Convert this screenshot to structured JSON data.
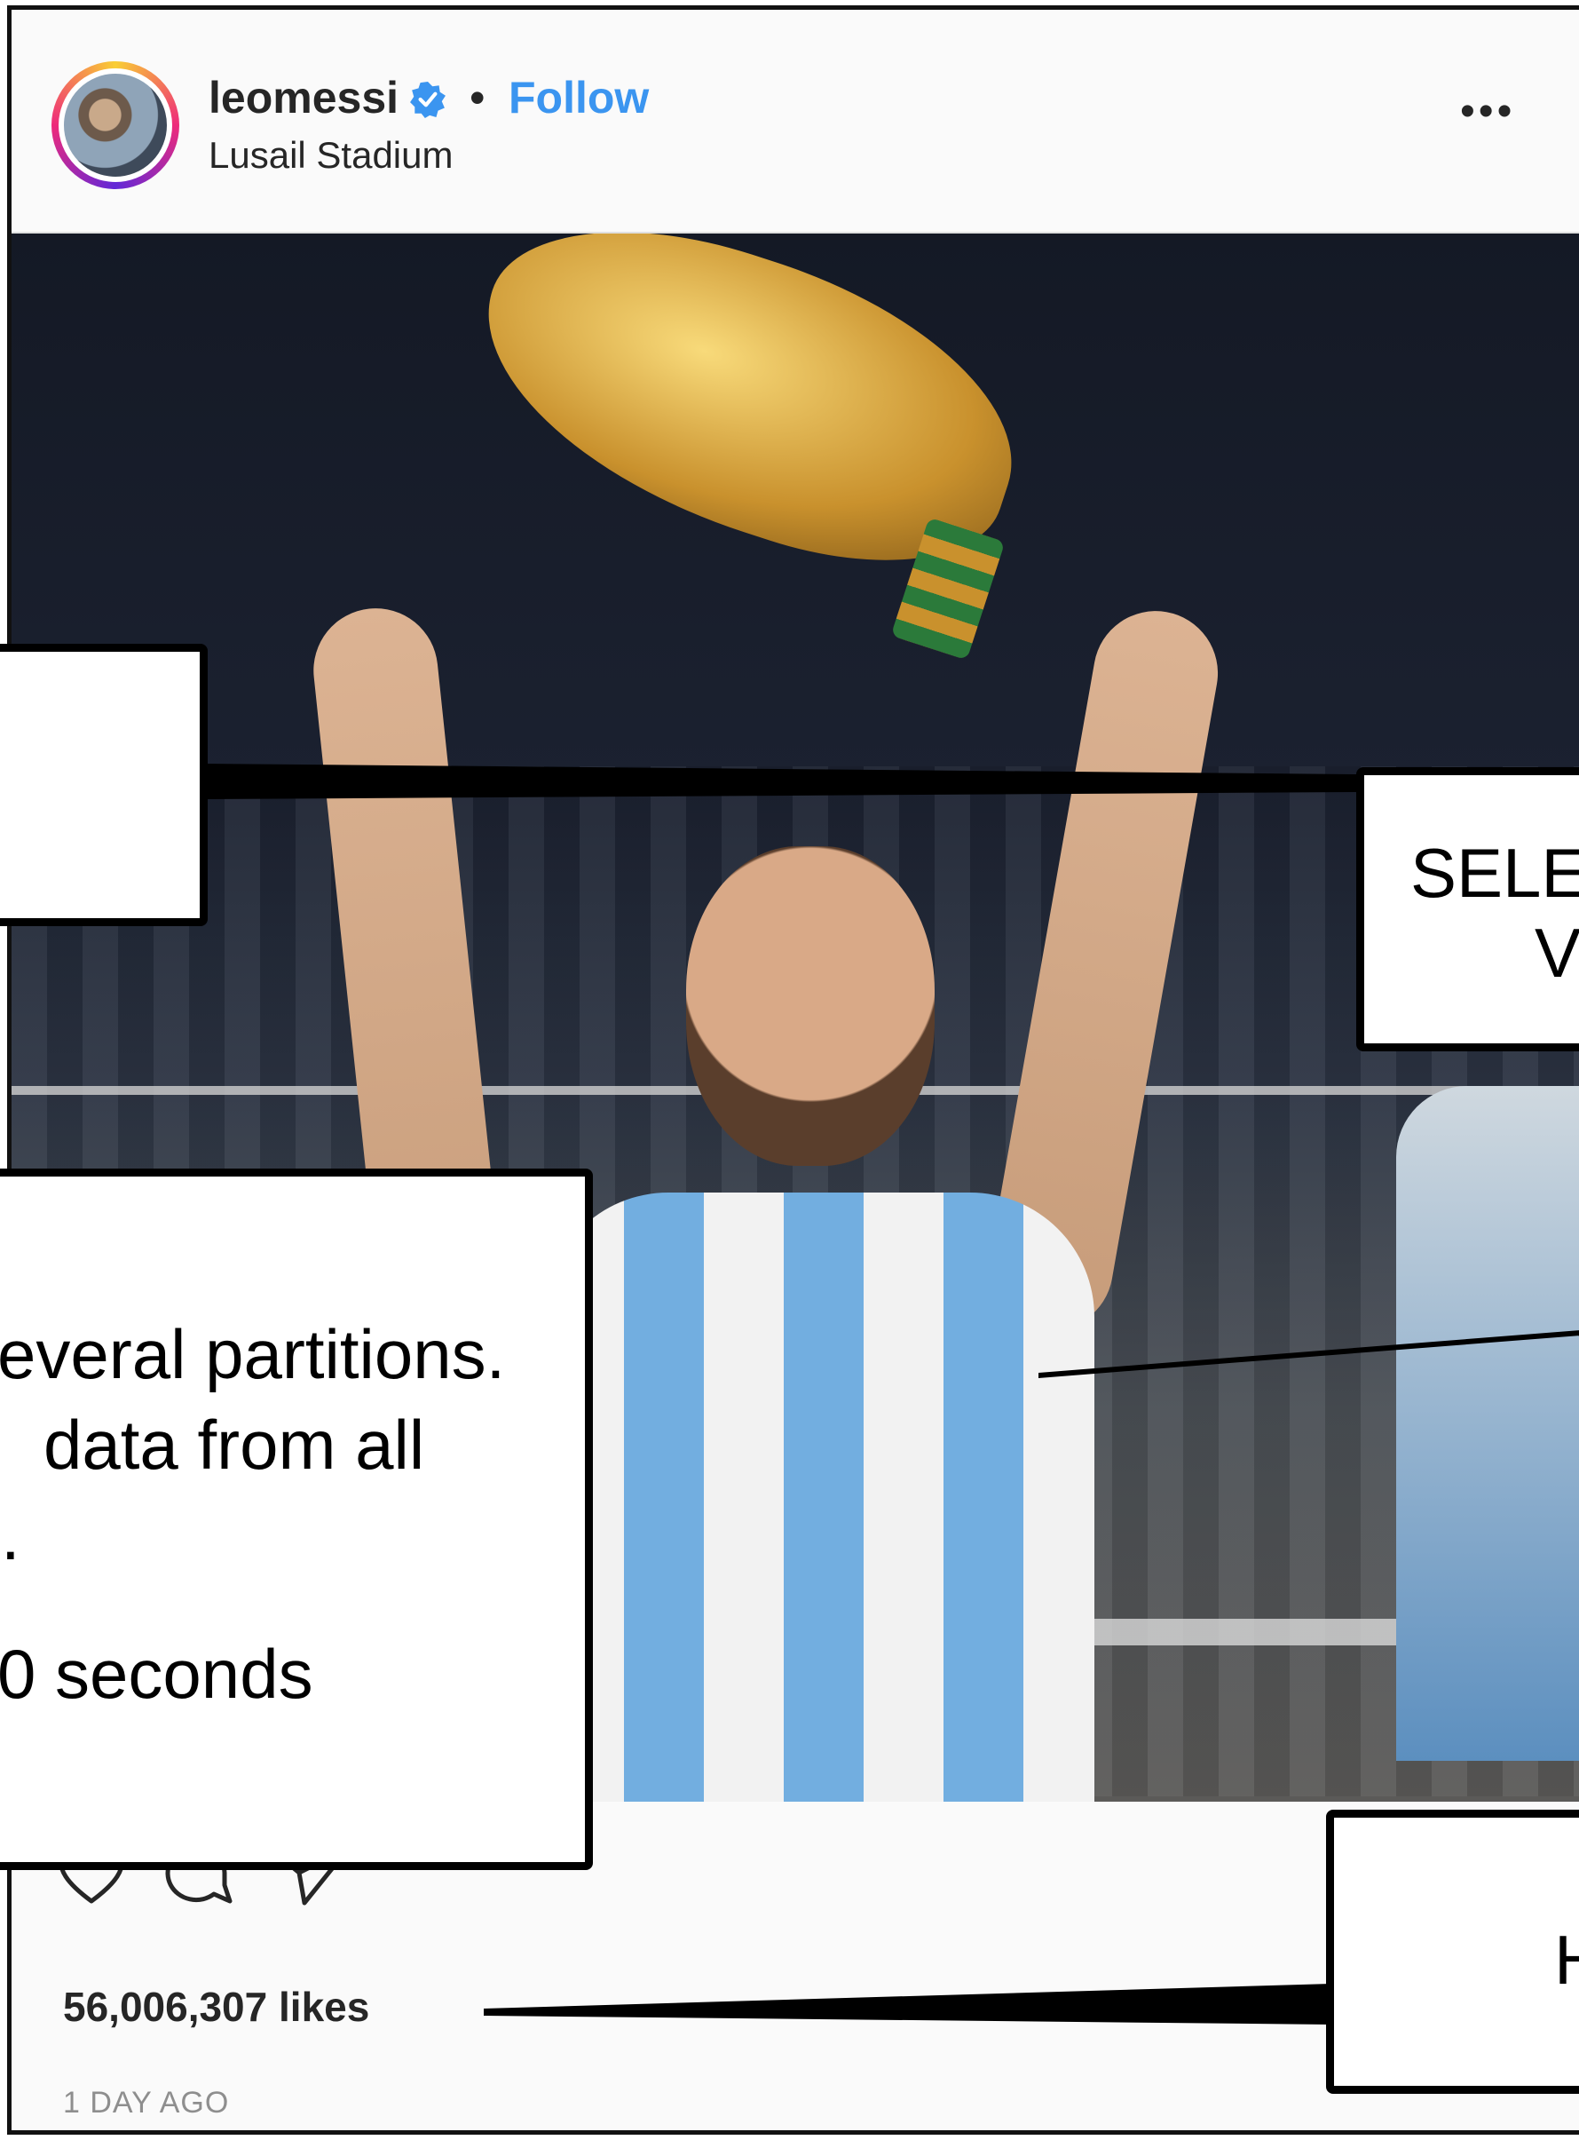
{
  "post": {
    "username": "leomessi",
    "follow_label": "Follow",
    "separator": "•",
    "location": "Lusail Stadium",
    "more_label": "•••",
    "likes_text": "56,006,307 likes",
    "date_text": "1 DAY AGO"
  },
  "icons": {
    "verified": "verified-badge-icon",
    "like": "heart-icon",
    "comment": "comment-icon",
    "share": "share-icon"
  },
  "callouts": {
    "top_right": "SELE",
    "top_right_line2": "V",
    "middle_left_line1": "everal partitions.",
    "middle_left_line2": "data from all",
    "middle_left_line3": ".",
    "middle_left_line4": "0 seconds",
    "bottom_right": "H"
  },
  "colors": {
    "follow_blue": "#3b95f0",
    "verified_blue": "#3b95f0",
    "text_dark": "#262626",
    "text_muted": "#8e8e8e"
  }
}
